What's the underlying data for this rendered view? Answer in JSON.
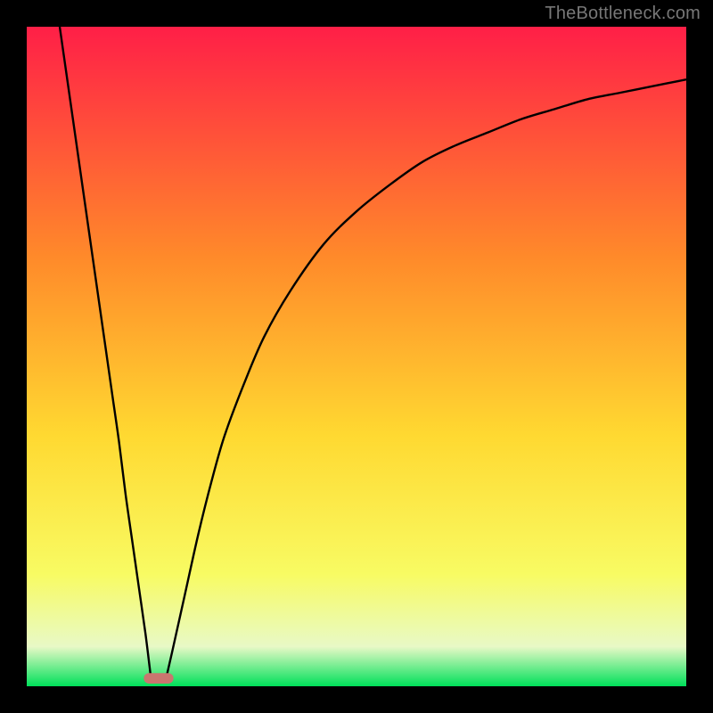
{
  "watermark": "TheBottleneck.com",
  "chart_data": {
    "type": "line",
    "title": "",
    "xlabel": "",
    "ylabel": "",
    "xlim": [
      0,
      100
    ],
    "ylim": [
      0,
      100
    ],
    "axes_visible": false,
    "background_gradient": {
      "top_color": "#ff1f47",
      "mid_upper_color": "#ff8a2a",
      "mid_color": "#ffd931",
      "mid_lower_color": "#f8fb63",
      "near_bottom_color": "#e8f9c6",
      "bottom_color": "#00e05a"
    },
    "frame_color": "#000000",
    "series": [
      {
        "name": "left-branch",
        "type": "line",
        "color": "#000000",
        "x": [
          5,
          6,
          7,
          8,
          9,
          10,
          11,
          12,
          13,
          14,
          15,
          16,
          17,
          18,
          18.8
        ],
        "y": [
          100,
          93,
          86,
          79,
          72,
          65,
          58,
          51,
          44,
          37,
          29,
          22,
          15,
          8,
          1.5
        ]
      },
      {
        "name": "right-branch",
        "type": "line",
        "color": "#000000",
        "x": [
          21.2,
          22,
          24,
          26,
          28,
          30,
          33,
          36,
          40,
          45,
          50,
          55,
          60,
          65,
          70,
          75,
          80,
          85,
          90,
          95,
          100
        ],
        "y": [
          1.5,
          5,
          14,
          23,
          31,
          38,
          46,
          53,
          60,
          67,
          72,
          76,
          79.5,
          82,
          84,
          86,
          87.5,
          89,
          90,
          91,
          92
        ]
      }
    ],
    "marker": {
      "name": "optimal-point-marker",
      "shape": "rounded-rect",
      "cx": 20,
      "cy": 1.2,
      "width": 4.5,
      "height": 1.6,
      "fill": "#c9766f"
    }
  }
}
